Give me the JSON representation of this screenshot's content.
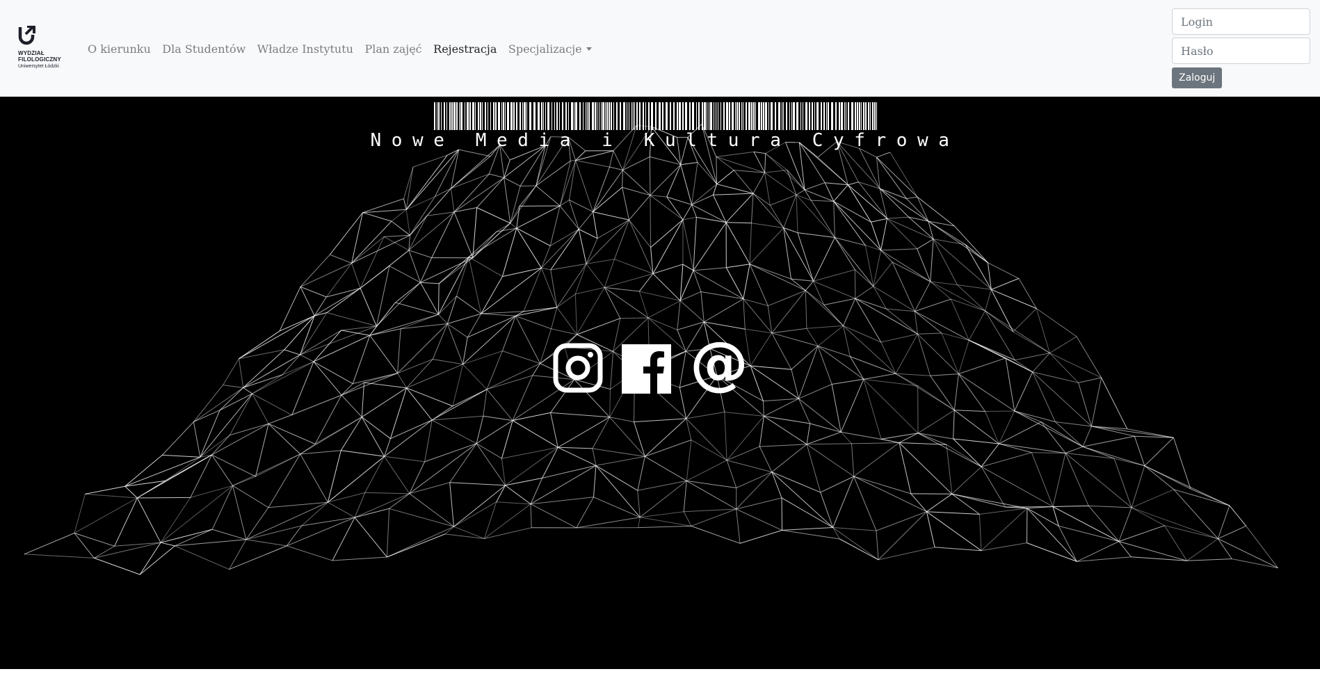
{
  "brand": {
    "name_line1": "WYDZIAŁ",
    "name_line2": "FILOLOGICZNY",
    "university": "Uniwersytet Łódzki"
  },
  "nav": {
    "items": [
      {
        "label": "O kierunku",
        "active": false
      },
      {
        "label": "Dla Studentów",
        "active": false
      },
      {
        "label": "Władze Instytutu",
        "active": false
      },
      {
        "label": "Plan zajęć",
        "active": false
      },
      {
        "label": "Rejestracja",
        "active": true
      },
      {
        "label": "Specjalizacje",
        "active": false,
        "dropdown": true
      }
    ]
  },
  "login": {
    "login_placeholder": "Login",
    "password_placeholder": "Hasło",
    "submit_label": "Zaloguj"
  },
  "hero": {
    "title": "Nowe Media i Kultura Cyfrowa",
    "background": "#000000",
    "mesh_color": "#ffffff"
  },
  "socials": [
    {
      "icon": "instagram-icon"
    },
    {
      "icon": "facebook-icon"
    },
    {
      "icon": "email-at-icon"
    }
  ],
  "colors": {
    "navbar_bg": "#f8f9fa",
    "nav_link": "#7a7d81",
    "nav_link_active": "#212529",
    "button_bg": "#6c757d"
  }
}
